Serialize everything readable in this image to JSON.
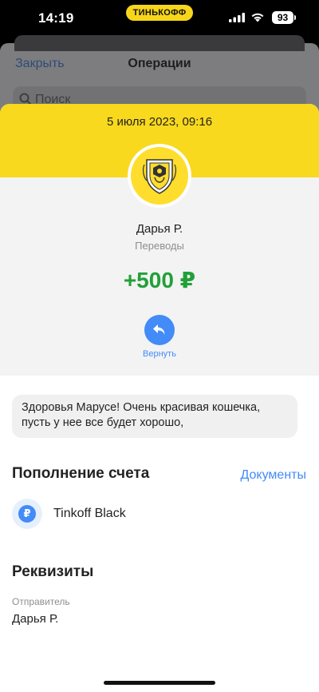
{
  "status_bar": {
    "time": "14:19",
    "carrier": "ТИНЬКОФФ",
    "battery": "93",
    "icons": [
      "signal-icon",
      "wifi-icon",
      "battery-icon"
    ]
  },
  "background_screen": {
    "close_label": "Закрыть",
    "title": "Операции",
    "search_placeholder": "Поиск"
  },
  "operation": {
    "date": "5 июля 2023, 09:16",
    "sender": "Дарья Р.",
    "category": "Переводы",
    "amount": "+500 ₽",
    "return_label": "Вернуть",
    "message": "Здоровья Марусе! Очень красивая кошечка, пусть у нее все будет хорошо,"
  },
  "replenishment": {
    "title": "Пополнение счета",
    "documents_link": "Документы",
    "account_icon_symbol": "₽",
    "account_name": "Tinkoff Black"
  },
  "details": {
    "title": "Реквизиты",
    "sender_label": "Отправитель",
    "sender_value": "Дарья Р."
  },
  "colors": {
    "brand_yellow": "#f8d91d",
    "accent_blue": "#428bf9",
    "amount_green": "#21a038"
  }
}
